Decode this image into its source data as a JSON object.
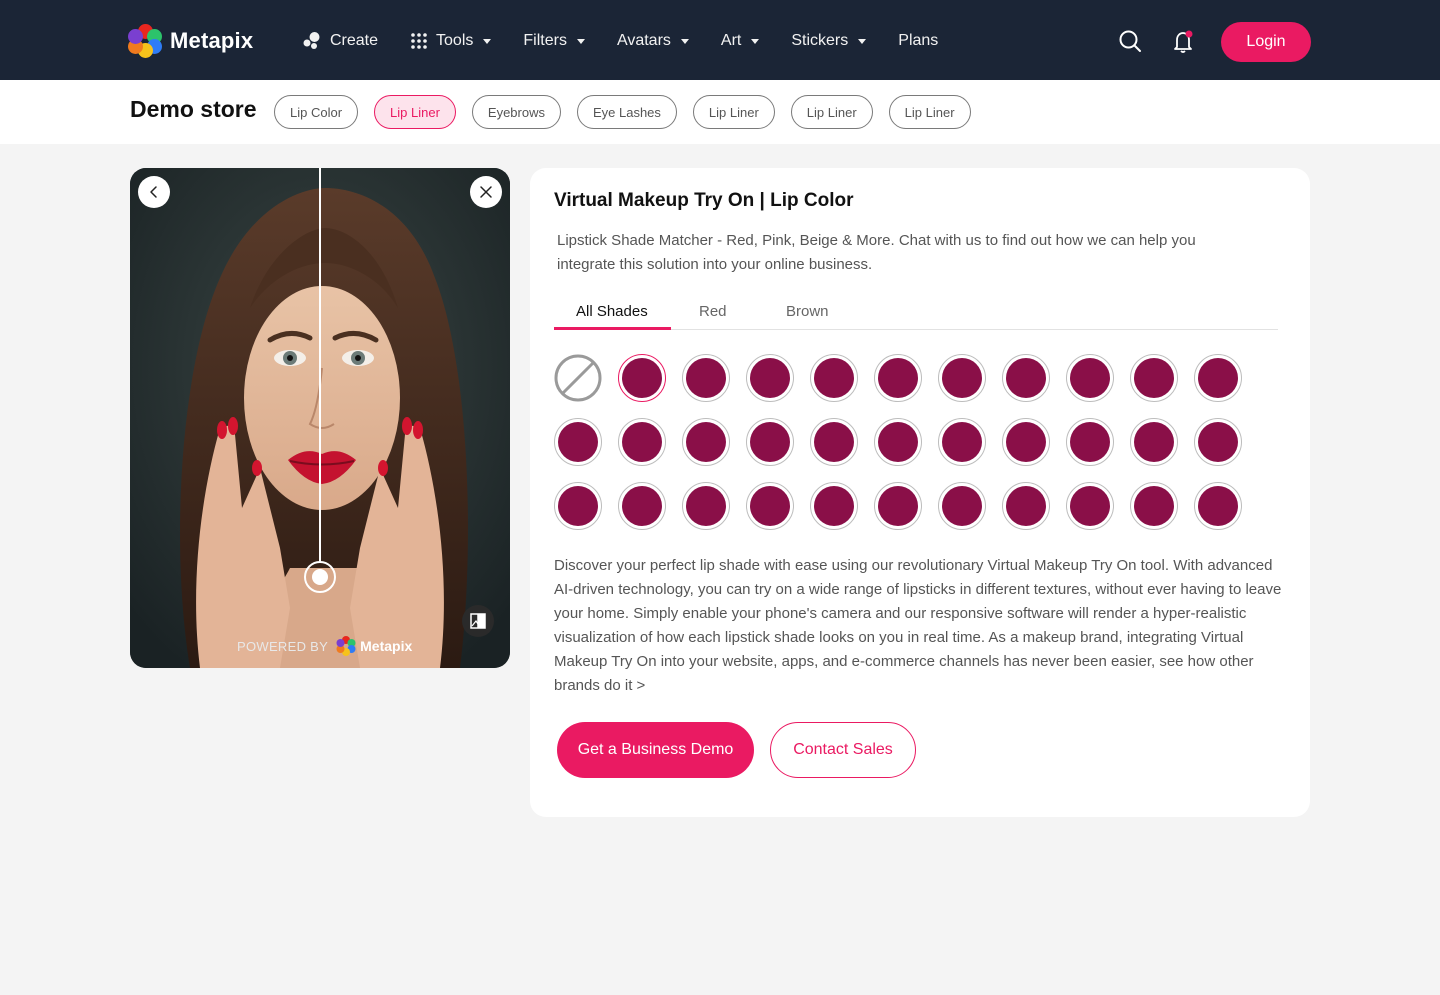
{
  "brand": {
    "name": "Metapix",
    "colors": {
      "accent": "#ea1a62",
      "navbar": "#1b2536",
      "shade": "#8a0f48"
    },
    "logo_dots": [
      "#e8261f",
      "#7a3fd0",
      "#2e7cf6",
      "#2cc36b",
      "#f6c21b",
      "#f07a1e"
    ]
  },
  "nav": {
    "items": [
      {
        "label": "Create",
        "icon": "create-icon",
        "dropdown": false
      },
      {
        "label": "Tools",
        "icon": "grid-icon",
        "dropdown": true
      },
      {
        "label": "Filters",
        "icon": "",
        "dropdown": true
      },
      {
        "label": "Avatars",
        "icon": "",
        "dropdown": true
      },
      {
        "label": "Art",
        "icon": "",
        "dropdown": true
      },
      {
        "label": "Stickers",
        "icon": "",
        "dropdown": true
      },
      {
        "label": "Plans",
        "icon": "",
        "dropdown": false
      }
    ],
    "search_icon": "search-icon",
    "notification_icon": "bell-icon",
    "login_label": "Login"
  },
  "store": {
    "title": "Demo store",
    "chips": [
      {
        "label": "Lip Color",
        "active": false
      },
      {
        "label": "Lip Liner",
        "active": true
      },
      {
        "label": "Eyebrows",
        "active": false
      },
      {
        "label": "Eye Lashes",
        "active": false
      },
      {
        "label": "Lip Liner",
        "active": false
      },
      {
        "label": "Lip Liner",
        "active": false
      },
      {
        "label": "Lip Liner",
        "active": false
      }
    ]
  },
  "viewer": {
    "back_icon": "chevron-left-icon",
    "close_icon": "close-icon",
    "compare_icon": "compare-icon",
    "powered_by": "POWERED BY",
    "powered_name": "Metapix"
  },
  "product": {
    "title": "Virtual Makeup Try On | Lip Color",
    "subtitle": "Lipstick Shade Matcher - Red, Pink, Beige & More. Chat with us to find out how we can help you integrate this solution into your online business.",
    "tabs": [
      {
        "label": "All Shades",
        "active": true
      },
      {
        "label": "Red",
        "active": false
      },
      {
        "label": "Brown",
        "active": false
      }
    ],
    "shades": {
      "none_icon": "no-shade-icon",
      "rows": 3,
      "columns": 11,
      "selected_index": 1,
      "color": "#8a0f48"
    },
    "description": "Discover your perfect lip shade with ease using our revolutionary Virtual Makeup Try On tool. With advanced AI-driven technology, you can try on a wide range of lipsticks in different textures, without ever having to leave your home. Simply enable your phone's camera and our responsive software will render a hyper-realistic visualization of how each lipstick shade looks on you in real time. As a makeup brand, integrating Virtual Makeup Try On into your website, apps, and e-commerce channels has never been easier, see how other brands do it >",
    "primary_button": "Get a Business Demo",
    "secondary_button": "Contact Sales"
  }
}
